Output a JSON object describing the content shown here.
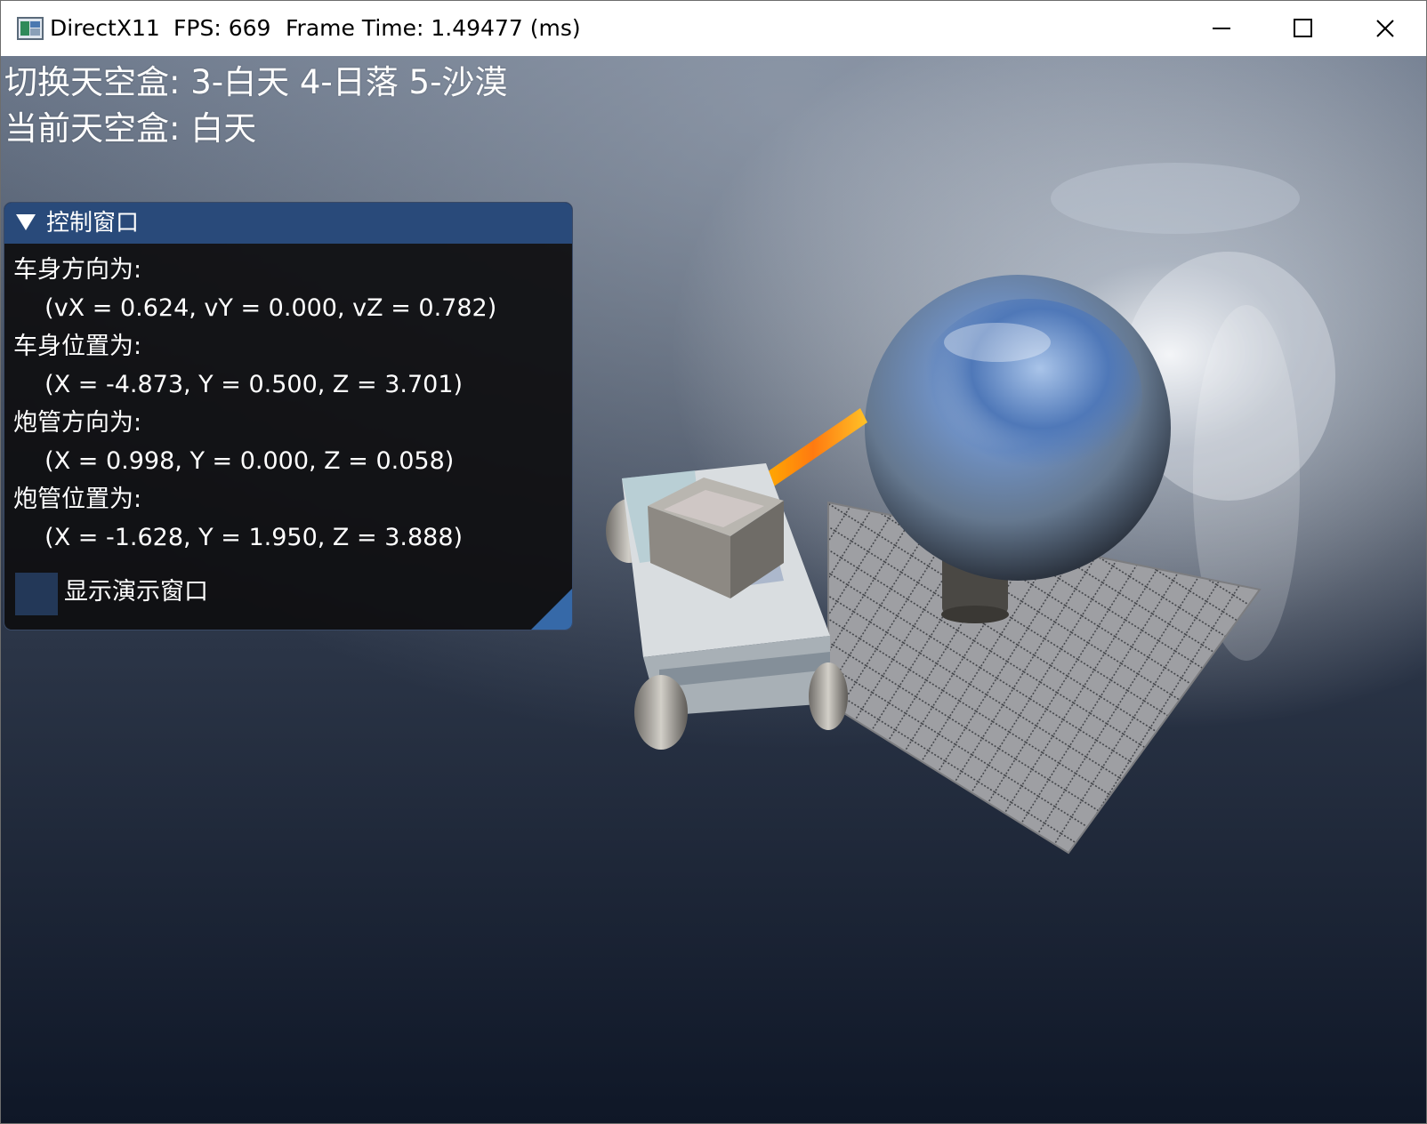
{
  "window": {
    "app_name": "DirectX11",
    "fps": "FPS: 669",
    "frame_time": "Frame Time: 1.49477 (ms)"
  },
  "overlay": {
    "line1": "切换天空盒: 3-白天 4-日落 5-沙漠",
    "line2": "当前天空盒: 白天"
  },
  "control_window": {
    "title": "控制窗口",
    "lines": [
      "车身方向为:",
      "  (vX = 0.624, vY = 0.000, vZ = 0.782)",
      "车身位置为:",
      "  (X = -4.873, Y = 0.500, Z = 3.701)",
      "炮管方向为:",
      "  (X = 0.998, Y = 0.000, Z = 0.058)",
      "炮管位置为:",
      "  (X = -1.628, Y = 1.950, Z = 3.888)"
    ],
    "checkbox_label": "显示演示窗口",
    "checkbox_checked": false
  },
  "colors": {
    "title_bar": "#294a7a",
    "window_bg": "#0f0f11",
    "checkbox": "#233858",
    "grip": "#3669a8"
  },
  "icons": [
    "app-icon",
    "minimize-icon",
    "maximize-icon",
    "close-icon",
    "collapse-arrow-icon"
  ]
}
